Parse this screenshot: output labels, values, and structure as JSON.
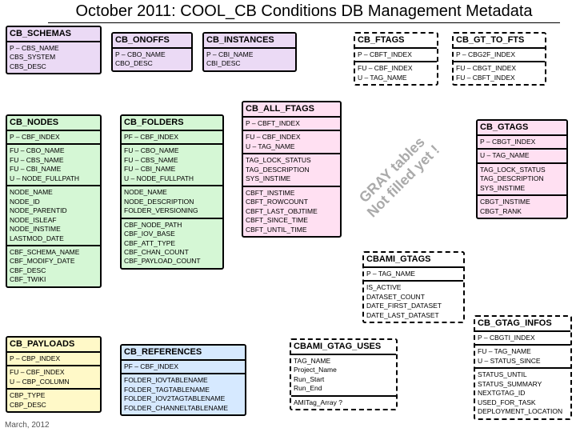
{
  "page": {
    "title": "October 2011: COOL_CB Conditions DB Management Metadata",
    "footer_date": "March, 2012",
    "watermark_l1": "GRAY tables",
    "watermark_l2": "Not filled yet !"
  },
  "schemas": {
    "hdr": "CB_SCHEMAS",
    "s1": [
      "P – CBS_NAME",
      "CBS_SYSTEM",
      "CBS_DESC"
    ]
  },
  "onoffs": {
    "hdr": "CB_ONOFFS",
    "s1": [
      "P – CBO_NAME",
      "CBO_DESC"
    ]
  },
  "instances": {
    "hdr": "CB_INSTANCES",
    "s1": [
      "P – CBI_NAME",
      "CBI_DESC"
    ]
  },
  "ftags": {
    "hdr": "CB_FTAGS",
    "s1": [
      "P – CBFT_INDEX"
    ],
    "s2": [
      "FU – CBF_INDEX",
      "U – TAG_NAME"
    ]
  },
  "gt2fts": {
    "hdr": "CB_GT_TO_FTS",
    "s1": [
      "P – CBG2F_INDEX"
    ],
    "s2": [
      "FU – CBGT_INDEX",
      "FU – CBFT_INDEX"
    ]
  },
  "nodes": {
    "hdr": "CB_NODES",
    "s1": [
      "P – CBF_INDEX"
    ],
    "s2": [
      "FU – CBO_NAME",
      "FU – CBS_NAME",
      "FU – CBI_NAME",
      "U – NODE_FULLPATH"
    ],
    "s3": [
      "NODE_NAME",
      "NODE_ID",
      "NODE_PARENTID",
      "NODE_ISLEAF",
      "NODE_INSTIME",
      "LASTMOD_DATE"
    ],
    "s4": [
      "CBF_SCHEMA_NAME",
      "CBF_MODIFY_DATE",
      "CBF_DESC",
      "CBF_TWIKI"
    ]
  },
  "folders": {
    "hdr": "CB_FOLDERS",
    "s1": [
      "PF – CBF_INDEX"
    ],
    "s2": [
      "FU – CBO_NAME",
      "FU – CBS_NAME",
      "FU – CBI_NAME",
      "U – NODE_FULLPATH"
    ],
    "s3": [
      "NODE_NAME",
      "NODE_DESCRIPTION",
      "FOLDER_VERSIONING"
    ],
    "s4": [
      "CBF_NODE_PATH",
      "CBF_IOV_BASE",
      "CBF_ATT_TYPE",
      "CBF_CHAN_COUNT",
      "CBF_PAYLOAD_COUNT"
    ]
  },
  "allftags": {
    "hdr": "CB_ALL_FTAGS",
    "s1": [
      "P – CBFT_INDEX"
    ],
    "s2": [
      "FU – CBF_INDEX",
      "U – TAG_NAME"
    ],
    "s3": [
      "TAG_LOCK_STATUS",
      "TAG_DESCRIPTION",
      "SYS_INSTIME"
    ],
    "s4": [
      "CBFT_INSTIME",
      "CBFT_ROWCOUNT",
      "CBFT_LAST_OBJTIME",
      "CBFT_SINCE_TIME",
      "CBFT_UNTIL_TIME"
    ]
  },
  "gtags": {
    "hdr": "CB_GTAGS",
    "s1": [
      "P – CBGT_INDEX"
    ],
    "s2": [
      "U – TAG_NAME"
    ],
    "s3": [
      "TAG_LOCK_STATUS",
      "TAG_DESCRIPTION",
      "SYS_INSTIME"
    ],
    "s4": [
      "CBGT_INSTIME",
      "CBGT_RANK"
    ]
  },
  "cbami_gtags": {
    "hdr": "CBAMI_GTAGS",
    "s1": [
      "P – TAG_NAME"
    ],
    "s2": [
      "IS_ACTIVE",
      "DATASET_COUNT",
      "DATE_FIRST_DATASET",
      "DATE_LAST_DATASET"
    ]
  },
  "gtag_infos": {
    "hdr": "CB_GTAG_INFOS",
    "s1": [
      "P – CBGTI_INDEX"
    ],
    "s2": [
      "FU – TAG_NAME",
      "U – STATUS_SINCE"
    ],
    "s3": [
      "STATUS_UNTIL",
      "STATUS_SUMMARY",
      "NEXTGTAG_ID",
      "USED_FOR_TASK",
      "DEPLOYMENT_LOCATION"
    ]
  },
  "payloads": {
    "hdr": "CB_PAYLOADS",
    "s1": [
      "P – CBP_INDEX"
    ],
    "s2": [
      "FU – CBF_INDEX",
      "U – CBP_COLUMN"
    ],
    "s3": [
      "CBP_TYPE",
      "CBP_DESC"
    ]
  },
  "references": {
    "hdr": "CB_REFERENCES",
    "s1": [
      "PF – CBF_INDEX"
    ],
    "s2": [
      "FOLDER_IOVTABLENAME",
      "FOLDER_TAGTABLENAME",
      "FOLDER_IOV2TAGTABLENAME",
      "FOLDER_CHANNELTABLENAME"
    ]
  },
  "cbami_gtag_uses": {
    "hdr": "CBAMI_GTAG_USES",
    "s1": [
      "TAG_NAME",
      "Project_Name",
      "Run_Start",
      "Run_End"
    ],
    "s2": [
      "AMITag_Array ?"
    ]
  }
}
